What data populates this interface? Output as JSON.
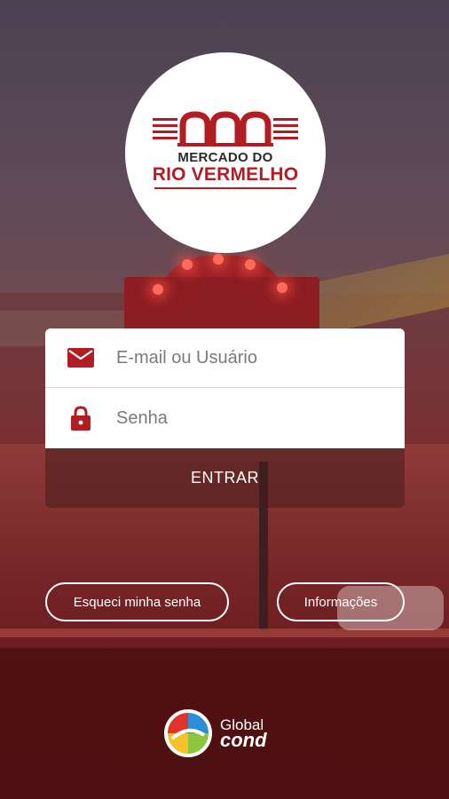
{
  "logo": {
    "line1": "MERCADO DO",
    "line2": "RIO VERMELHO",
    "brand_color": "#b01e24"
  },
  "login": {
    "email_placeholder": "E-mail ou Usuário",
    "email_icon": "envelope-icon",
    "password_placeholder": "Senha",
    "password_icon": "lock-icon",
    "submit_label": "ENTRAR"
  },
  "actions": {
    "forgot_label": "Esqueci minha senha",
    "info_label": "Informações"
  },
  "footer": {
    "brand_word1": "Global",
    "brand_word2": "cond"
  }
}
